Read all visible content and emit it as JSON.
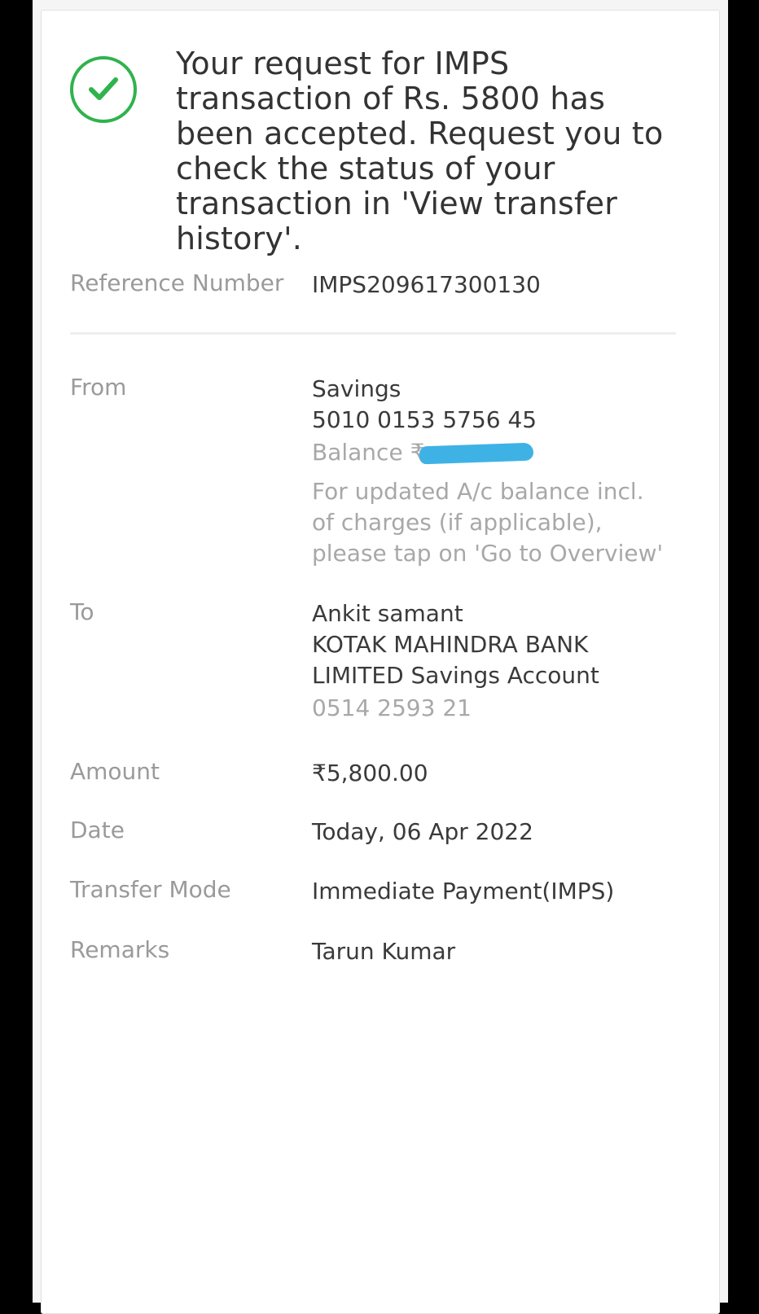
{
  "status": {
    "icon": "check-circle-icon",
    "accent_color": "#2fb34d",
    "message": "Your request for IMPS transaction of Rs. 5800 has been accepted. Request you to check the status of your transaction in 'View transfer history'."
  },
  "reference": {
    "label": "Reference Number",
    "value": "IMPS209617300130"
  },
  "from": {
    "label": "From",
    "account_type": "Savings",
    "account_number": "5010 0153 5756 45",
    "balance_label": "Balance ₹",
    "note": "For updated A/c balance incl. of charges (if applicable), please tap on 'Go to Overview'"
  },
  "to": {
    "label": "To",
    "name": "Ankit samant",
    "bank": "KOTAK MAHINDRA BANK LIMITED Savings Account",
    "account_number": "0514 2593 21"
  },
  "amount": {
    "label": "Amount",
    "value": "₹5,800.00"
  },
  "date": {
    "label": "Date",
    "value": "Today, 06 Apr 2022"
  },
  "transfer_mode": {
    "label": "Transfer Mode",
    "value": "Immediate Payment(IMPS)"
  },
  "remarks": {
    "label": "Remarks",
    "value": "Tarun Kumar"
  }
}
